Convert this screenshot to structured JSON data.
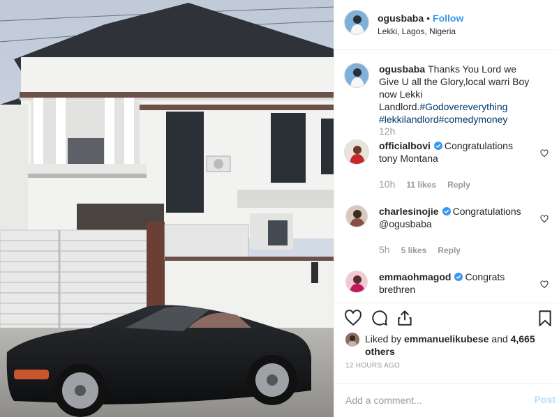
{
  "post": {
    "username": "ogusbaba",
    "separator": "•",
    "follow_label": "Follow",
    "location": "Lekki, Lagos, Nigeria",
    "caption_text": "Thanks You Lord we Give U all the Glory,local warri Boy now Lekki Landlord.",
    "caption_tags": [
      "#Godovereverything",
      "#lekkilandlord",
      "#comedymoney"
    ],
    "caption_time": "12h"
  },
  "comments": [
    {
      "username": "officialbovi",
      "verified": true,
      "text": "Congratulations tony Montana",
      "time": "10h",
      "likes": "11 likes",
      "reply": "Reply"
    },
    {
      "username": "charlesinojie",
      "verified": true,
      "text": "Congratulations @ogusbaba",
      "time": "5h",
      "likes": "5 likes",
      "reply": "Reply"
    },
    {
      "username": "emmaohmagod",
      "verified": true,
      "text": "Congrats brethren"
    }
  ],
  "likes": {
    "prefix": "Liked by",
    "user": "emmanuelikubese",
    "connector": "and",
    "others": "4,665 others"
  },
  "timestamp": "12 HOURS AGO",
  "comment_box": {
    "placeholder": "Add a comment...",
    "post_label": "Post"
  },
  "icons": [
    "heart-icon",
    "comment-icon",
    "share-icon",
    "bookmark-icon",
    "verified-badge-icon"
  ],
  "colors": {
    "link": "#3897f0",
    "hashtag": "#003569",
    "muted": "#999999",
    "post_disabled": "#b2dffc",
    "verified": "#3897f0"
  }
}
